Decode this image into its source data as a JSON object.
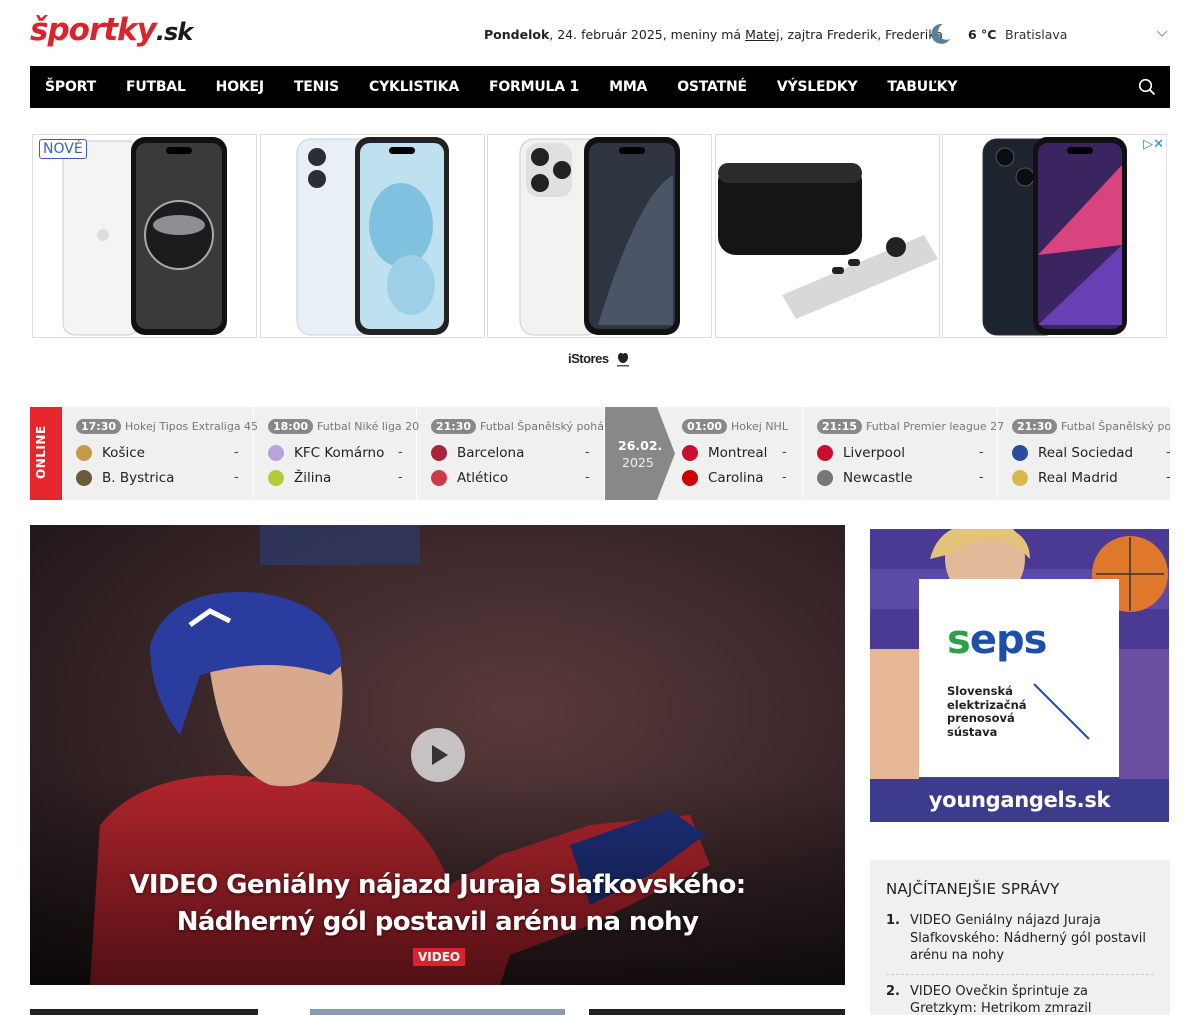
{
  "header": {
    "logo": {
      "part1": "šport",
      "part2": "ky",
      "part3": ".sk"
    },
    "date": {
      "day": "Pondelok",
      "rest": ", 24. február 2025, meniny má ",
      "name_today": "Matej",
      "tomorrow": ", zajtra Frederik, Frederika"
    },
    "weather": {
      "temp": "6 °C",
      "city": "Bratislava"
    }
  },
  "nav": {
    "items": [
      "ŠPORT",
      "FUTBAL",
      "HOKEJ",
      "TENIS",
      "CYKLISTIKA",
      "FORMULA 1",
      "MMA",
      "OSTATNÉ",
      "VÝSLEDKY",
      "TABUĽKY"
    ]
  },
  "ad": {
    "badge": "NOVÉ",
    "brand": "iStores",
    "adchoices": "▷✕"
  },
  "scores": {
    "online_label": "ONLINE",
    "date_divider": {
      "date": "26.02.",
      "year": "2025"
    },
    "matches": [
      {
        "time": "17:30",
        "league": "Hokej Tipos Extraliga 45",
        "home": "Košice",
        "away": "B. Bystrica",
        "home_score": "-",
        "away_score": "-"
      },
      {
        "time": "18:00",
        "league": "Futbal Niké liga 20",
        "home": "KFC Komárno",
        "away": "Žilina",
        "home_score": "-",
        "away_score": "-"
      },
      {
        "time": "21:30",
        "league": "Futbal Španělský pohár",
        "home": "Barcelona",
        "away": "Atlético",
        "home_score": "-",
        "away_score": "-"
      },
      {
        "time": "01:00",
        "league": "Hokej NHL",
        "home": "Montreal",
        "away": "Carolina",
        "home_score": "-",
        "away_score": "-"
      },
      {
        "time": "21:15",
        "league": "Futbal Premier league 27",
        "home": "Liverpool",
        "away": "Newcastle",
        "home_score": "-",
        "away_score": "-"
      },
      {
        "time": "21:30",
        "league": "Futbal Španělský pohár",
        "home": "Real Sociedad",
        "away": "Real Madrid",
        "home_score": "-",
        "away_score": "-"
      }
    ]
  },
  "hero": {
    "title": "VIDEO Geniálny nájazd Juraja Slafkovského: Nádherný gól postavil arénu na nohy",
    "badge": "VIDEO"
  },
  "side_ad": {
    "logo": "seps",
    "subtitle_l1": "Slovenská",
    "subtitle_l2": "elektrizačná",
    "subtitle_l3": "prenosová",
    "subtitle_l4": "sústava",
    "site": "youngangels.sk"
  },
  "most_read": {
    "title": "NAJČÍTANEJŠIE SPRÁVY",
    "items": [
      {
        "n": "1.",
        "text": "VIDEO Geniálny nájazd Juraja Slafkovského: Nádherný gól postavil arénu na nohy"
      },
      {
        "n": "2.",
        "text": "VIDEO Ovečkin šprintuje za Gretzkym: Hetrikom zmrazil Edmonton"
      }
    ]
  },
  "colors": {
    "brand_red": "#d9232d",
    "nav_bg": "#000000",
    "score_bg": "#f0f0f0"
  }
}
